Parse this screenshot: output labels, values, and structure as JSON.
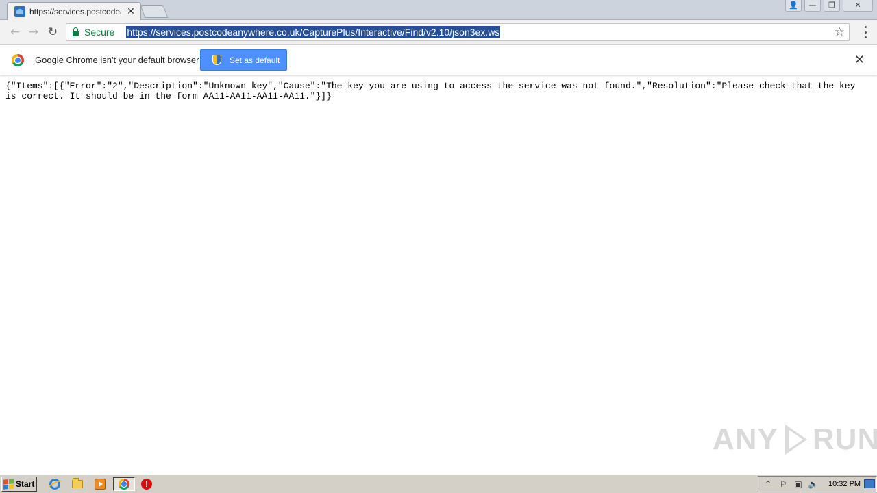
{
  "browser": {
    "tab_title": "https://services.postcodear",
    "tab_close_glyph": "✕",
    "window_controls": {
      "user_glyph": "👤",
      "minimize_glyph": "—",
      "restore_glyph": "❐",
      "close_glyph": "✕"
    },
    "nav": {
      "back_glyph": "←",
      "forward_glyph": "→",
      "reload_glyph": "↻"
    },
    "omnibox": {
      "secure_label": "Secure",
      "url": "https://services.postcodeanywhere.co.uk/CapturePlus/Interactive/Find/v2.10/json3ex.ws",
      "url_selected": true,
      "star_glyph": "☆"
    }
  },
  "infobar": {
    "message": "Google Chrome isn't your default browser",
    "button_label": "Set as default",
    "close_glyph": "✕"
  },
  "page": {
    "body_text": "{\"Items\":[{\"Error\":\"2\",\"Description\":\"Unknown key\",\"Cause\":\"The key you are using to access the service was not found.\",\"Resolution\":\"Please check that the key is correct. It should be in the form AA11-AA11-AA11-AA11.\"}]}"
  },
  "watermark": {
    "left_text": "ANY",
    "right_text": "RUN"
  },
  "taskbar": {
    "start_label": "Start",
    "pinned_icons": [
      "internet-explorer-icon",
      "folder-icon",
      "media-player-icon",
      "chrome-icon",
      "stop-icon"
    ],
    "stop_glyph": "!",
    "tray": {
      "expand_glyph": "⌃",
      "flag_glyph": "⚐",
      "network_glyph": "▣",
      "volume_glyph": "🔈",
      "time": "10:32 PM"
    }
  },
  "colors": {
    "selection": "#264f9a",
    "secure_green": "#0b8043",
    "button_blue": "#4d90fe",
    "taskbar": "#d4d0c8"
  }
}
